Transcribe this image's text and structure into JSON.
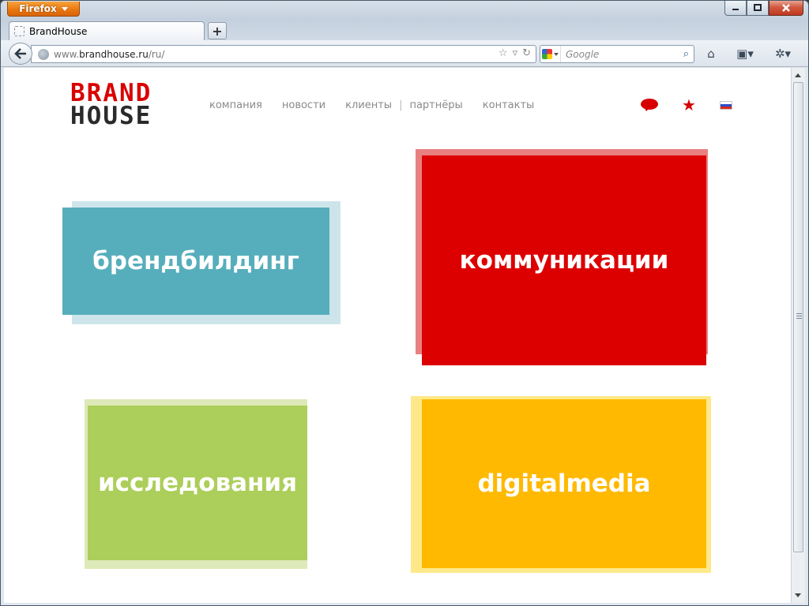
{
  "browser": {
    "app_button": "Firefox",
    "tab_title": "BrandHouse",
    "url_prefix": "www.",
    "url_domain": "brandhouse.ru",
    "url_path": "/ru/",
    "search_placeholder": "Google",
    "window_controls": [
      "minimize",
      "maximize",
      "close"
    ]
  },
  "site": {
    "logo_top": "BRAND",
    "logo_bottom": "HOUSE",
    "nav": {
      "company": "компания",
      "news": "новости",
      "clients": "клиенты",
      "separator": "|",
      "partners": "партнёры",
      "contacts": "контакты"
    },
    "icons": [
      "speech-bubble-icon",
      "star-icon",
      "russian-flag-icon"
    ],
    "tiles": [
      {
        "label": "брендбилдинг",
        "color": "#56aebc",
        "ghost_color": "#cde5ea"
      },
      {
        "label": "коммуникации",
        "color": "#dd0000",
        "ghost_color": "#e98080"
      },
      {
        "label": "исследования",
        "color": "#acce5a",
        "ghost_color": "#dde9b8"
      },
      {
        "label": "digitalmedia",
        "color": "#ffb900",
        "ghost_color": "#fde98a"
      }
    ]
  }
}
